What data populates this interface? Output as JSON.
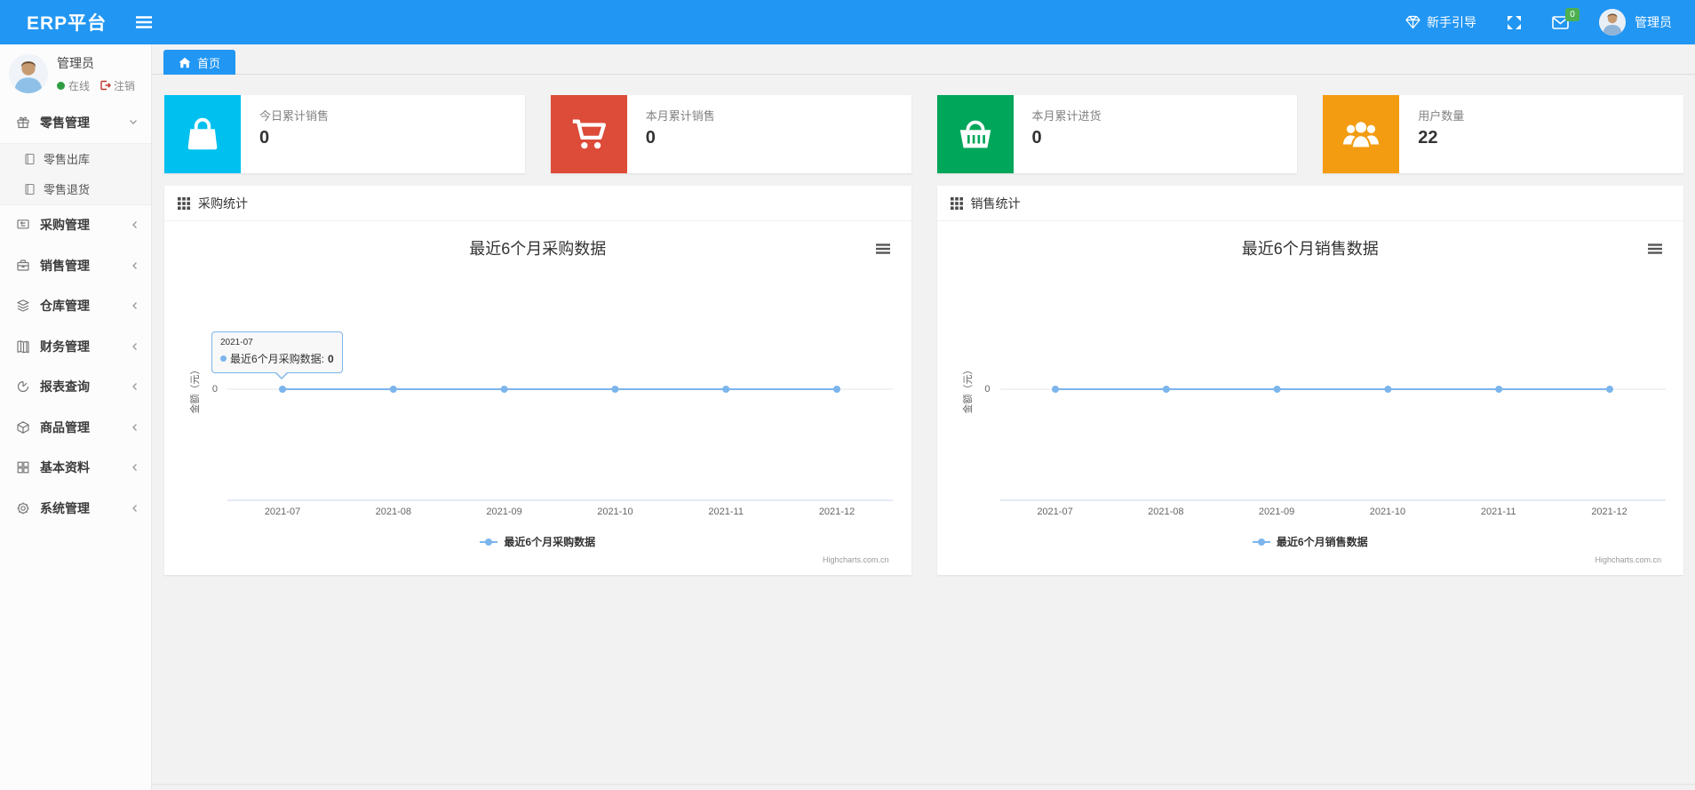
{
  "header": {
    "logo": "ERP平台",
    "guide_label": "新手引导",
    "message_badge": "0",
    "username": "管理员"
  },
  "sidebar": {
    "user": {
      "name": "管理员",
      "status": "在线",
      "logout": "注销"
    },
    "menu": [
      {
        "label": "零售管理",
        "icon": "gift-icon",
        "expanded": true,
        "children": [
          {
            "label": "零售出库"
          },
          {
            "label": "零售退货"
          }
        ]
      },
      {
        "label": "采购管理",
        "icon": "purchase-icon"
      },
      {
        "label": "销售管理",
        "icon": "briefcase-icon"
      },
      {
        "label": "仓库管理",
        "icon": "layers-icon"
      },
      {
        "label": "财务管理",
        "icon": "finance-book-icon"
      },
      {
        "label": "报表查询",
        "icon": "pie-chart-icon"
      },
      {
        "label": "商品管理",
        "icon": "goods-box-icon"
      },
      {
        "label": "基本资料",
        "icon": "grid-icon"
      },
      {
        "label": "系统管理",
        "icon": "gear-icon"
      }
    ]
  },
  "tabs": {
    "home": "首页"
  },
  "stat_cards": [
    {
      "label": "今日累计销售",
      "value": "0",
      "color": "#00c0ef",
      "icon": "shopping-bag-icon"
    },
    {
      "label": "本月累计销售",
      "value": "0",
      "color": "#dd4b39",
      "icon": "shopping-cart-icon"
    },
    {
      "label": "本月累计进货",
      "value": "0",
      "color": "#00a65a",
      "icon": "shopping-basket-icon"
    },
    {
      "label": "用户数量",
      "value": "22",
      "color": "#f39c12",
      "icon": "users-icon"
    }
  ],
  "panels": [
    {
      "title": "采购统计"
    },
    {
      "title": "销售统计"
    }
  ],
  "chart_data": [
    {
      "type": "line",
      "title": "最近6个月采购数据",
      "categories": [
        "2021-07",
        "2021-08",
        "2021-09",
        "2021-10",
        "2021-11",
        "2021-12"
      ],
      "series": [
        {
          "name": "最近6个月采购数据",
          "values": [
            0,
            0,
            0,
            0,
            0,
            0
          ],
          "color": "#7cb5ec"
        }
      ],
      "xlabel": "",
      "ylabel": "金额（元）",
      "yticks": [
        "0"
      ],
      "ylim": [
        0,
        0
      ],
      "grid": true,
      "legend_position": "bottom",
      "credit": "Highcharts.com.cn",
      "tooltip": {
        "visible": true,
        "title": "2021-07",
        "series": "最近6个月采购数据",
        "value": "0"
      }
    },
    {
      "type": "line",
      "title": "最近6个月销售数据",
      "categories": [
        "2021-07",
        "2021-08",
        "2021-09",
        "2021-10",
        "2021-11",
        "2021-12"
      ],
      "series": [
        {
          "name": "最近6个月销售数据",
          "values": [
            0,
            0,
            0,
            0,
            0,
            0
          ],
          "color": "#7cb5ec"
        }
      ],
      "xlabel": "",
      "ylabel": "金额（元）",
      "yticks": [
        "0"
      ],
      "ylim": [
        0,
        0
      ],
      "grid": true,
      "legend_position": "bottom",
      "credit": "Highcharts.com.cn",
      "tooltip": {
        "visible": false
      }
    }
  ],
  "colors": {
    "header_blue": "#2196f3",
    "series_blue": "#7cb5ec",
    "gridline": "#e6e6e6",
    "axis_line": "#ccd6eb",
    "badge_green": "#4caf50"
  }
}
